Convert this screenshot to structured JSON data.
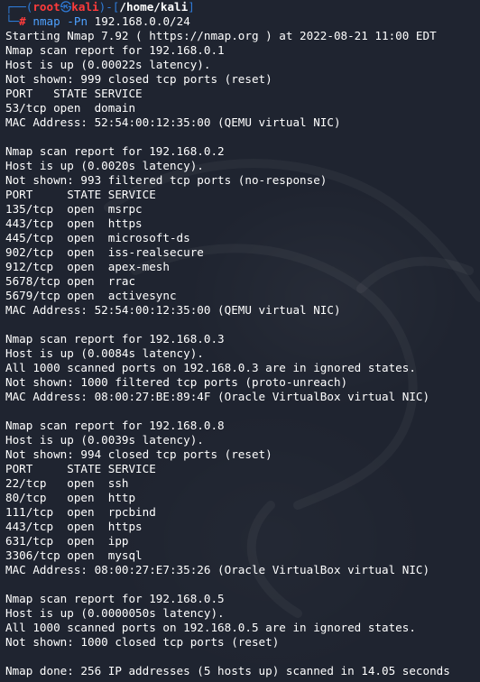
{
  "prompt": {
    "user": "root",
    "host": "kali",
    "path": "/home/kali",
    "symbol": "#",
    "command": "nmap",
    "flag": "-Pn",
    "target": "192.168.0.0/24"
  },
  "output_lines": [
    "Starting Nmap 7.92 ( https://nmap.org ) at 2022-08-21 11:00 EDT",
    "Nmap scan report for 192.168.0.1",
    "Host is up (0.00022s latency).",
    "Not shown: 999 closed tcp ports (reset)",
    "PORT   STATE SERVICE",
    "53/tcp open  domain",
    "MAC Address: 52:54:00:12:35:00 (QEMU virtual NIC)",
    "",
    "Nmap scan report for 192.168.0.2",
    "Host is up (0.0020s latency).",
    "Not shown: 993 filtered tcp ports (no-response)",
    "PORT     STATE SERVICE",
    "135/tcp  open  msrpc",
    "443/tcp  open  https",
    "445/tcp  open  microsoft-ds",
    "902/tcp  open  iss-realsecure",
    "912/tcp  open  apex-mesh",
    "5678/tcp open  rrac",
    "5679/tcp open  activesync",
    "MAC Address: 52:54:00:12:35:00 (QEMU virtual NIC)",
    "",
    "Nmap scan report for 192.168.0.3",
    "Host is up (0.0084s latency).",
    "All 1000 scanned ports on 192.168.0.3 are in ignored states.",
    "Not shown: 1000 filtered tcp ports (proto-unreach)",
    "MAC Address: 08:00:27:BE:89:4F (Oracle VirtualBox virtual NIC)",
    "",
    "Nmap scan report for 192.168.0.8",
    "Host is up (0.0039s latency).",
    "Not shown: 994 closed tcp ports (reset)",
    "PORT     STATE SERVICE",
    "22/tcp   open  ssh",
    "80/tcp   open  http",
    "111/tcp  open  rpcbind",
    "443/tcp  open  https",
    "631/tcp  open  ipp",
    "3306/tcp open  mysql",
    "MAC Address: 08:00:27:E7:35:26 (Oracle VirtualBox virtual NIC)",
    "",
    "Nmap scan report for 192.168.0.5",
    "Host is up (0.0000050s latency).",
    "All 1000 scanned ports on 192.168.0.5 are in ignored states.",
    "Not shown: 1000 closed tcp ports (reset)",
    "",
    "Nmap done: 256 IP addresses (5 hosts up) scanned in 14.05 seconds"
  ],
  "colors": {
    "background": "#1f2430",
    "prompt_frame": "#2f7bd8",
    "user_host": "#ff3b3b",
    "command": "#4ea1ff",
    "text": "#ffffff"
  }
}
